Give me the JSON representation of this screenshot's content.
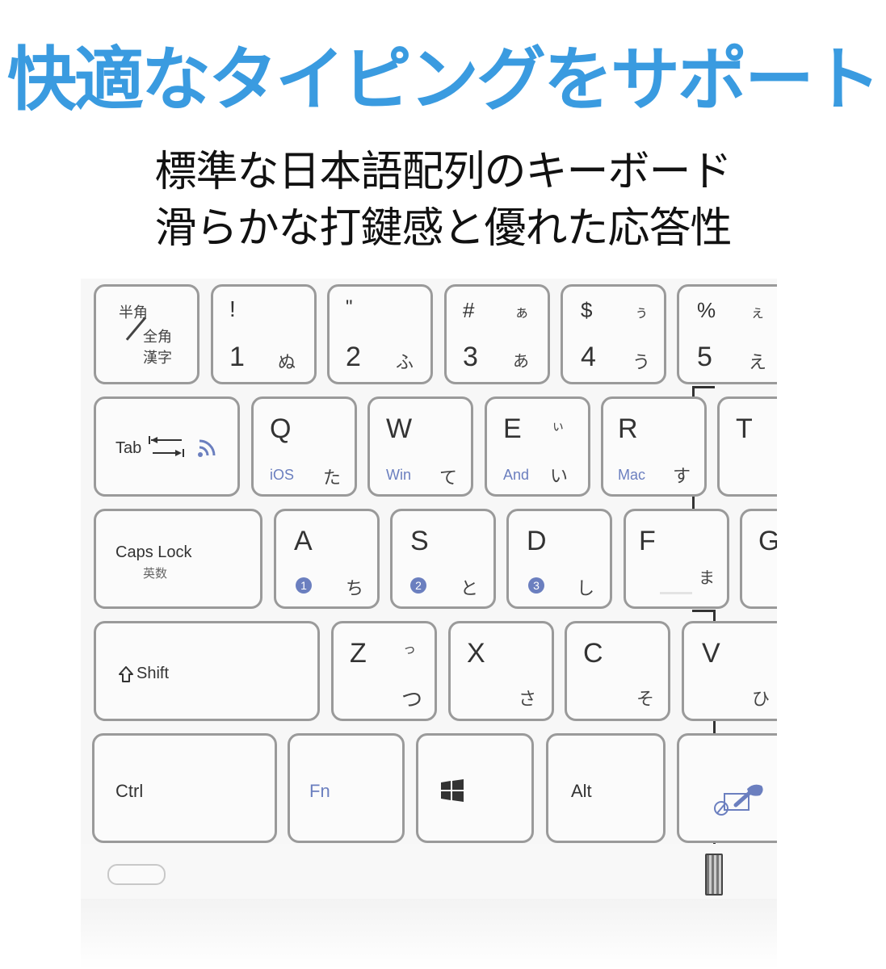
{
  "headline": {
    "text": "快適なタイピングをサポート",
    "color": "#3a9be0"
  },
  "subheadings": [
    "標準な日本語配列のキーボード",
    "滑らかな打鍵感と優れた応答性"
  ],
  "accent_key_color": "#6b7fbf",
  "keyboard": {
    "row1": [
      {
        "id": "hankaku",
        "top": "半角",
        "mid": "全角",
        "bottom": "漢字"
      },
      {
        "id": "1",
        "shift": "!",
        "main": "1",
        "kana": "ぬ",
        "kana_shift": ""
      },
      {
        "id": "2",
        "shift": "\"",
        "main": "2",
        "kana": "ふ",
        "kana_shift": ""
      },
      {
        "id": "3",
        "shift": "#",
        "main": "3",
        "kana": "あ",
        "kana_shift": "ぁ"
      },
      {
        "id": "4",
        "shift": "$",
        "main": "4",
        "kana": "う",
        "kana_shift": "ぅ"
      },
      {
        "id": "5",
        "shift": "%",
        "main": "5",
        "kana": "え",
        "kana_shift": "ぇ"
      }
    ],
    "row2": [
      {
        "id": "tab",
        "label": "Tab",
        "icon": "tab-arrows-icon",
        "extra_icon": "bluetooth-signal-icon"
      },
      {
        "id": "q",
        "main": "Q",
        "os": "iOS",
        "kana": "た",
        "kana_shift": ""
      },
      {
        "id": "w",
        "main": "W",
        "os": "Win",
        "kana": "て",
        "kana_shift": ""
      },
      {
        "id": "e",
        "main": "E",
        "os": "And",
        "kana": "い",
        "kana_shift": "ぃ"
      },
      {
        "id": "r",
        "main": "R",
        "os": "Mac",
        "kana": "す",
        "kana_shift": ""
      },
      {
        "id": "t",
        "main": "T"
      }
    ],
    "row3": [
      {
        "id": "capslock",
        "label": "Caps Lock",
        "sub": "英数"
      },
      {
        "id": "a",
        "main": "A",
        "badge": "1",
        "kana": "ち"
      },
      {
        "id": "s",
        "main": "S",
        "badge": "2",
        "kana": "と"
      },
      {
        "id": "d",
        "main": "D",
        "badge": "3",
        "kana": "し"
      },
      {
        "id": "f",
        "main": "F",
        "kana": "ま"
      },
      {
        "id": "g",
        "main": "G"
      }
    ],
    "row4": [
      {
        "id": "shift",
        "label": "Shift",
        "icon": "shift-arrow-icon"
      },
      {
        "id": "z",
        "main": "Z",
        "kana": "つ",
        "kana_shift": "っ"
      },
      {
        "id": "x",
        "main": "X",
        "kana": "さ"
      },
      {
        "id": "c",
        "main": "C",
        "kana": "そ"
      },
      {
        "id": "v",
        "main": "V",
        "kana": "ひ"
      }
    ],
    "row5": [
      {
        "id": "ctrl",
        "label": "Ctrl"
      },
      {
        "id": "fn",
        "label": "Fn"
      },
      {
        "id": "win",
        "icon": "windows-logo-icon"
      },
      {
        "id": "alt",
        "label": "Alt"
      },
      {
        "id": "touchpad",
        "icon": "touchpad-toggle-icon"
      }
    ]
  }
}
